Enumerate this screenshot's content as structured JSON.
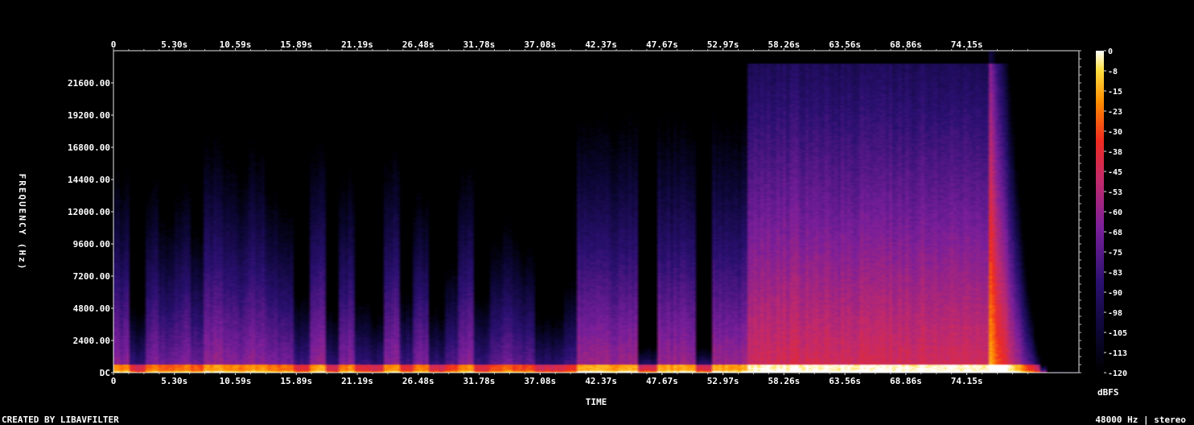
{
  "chart_data": {
    "type": "heatmap",
    "title": "",
    "xlabel": "TIME",
    "ylabel": "FREQUENCY (Hz)",
    "x_ticks": [
      "0",
      "5.30s",
      "10.59s",
      "15.89s",
      "21.19s",
      "26.48s",
      "31.78s",
      "37.08s",
      "42.37s",
      "47.67s",
      "52.97s",
      "58.26s",
      "63.56s",
      "68.86s",
      "74.15s"
    ],
    "x_range_s": [
      0,
      83.9
    ],
    "y_ticks": [
      "DC",
      "2400.00",
      "4800.00",
      "7200.00",
      "9600.00",
      "12000.00",
      "14400.00",
      "16800.00",
      "19200.00",
      "21600.00"
    ],
    "y_range_hz": [
      0,
      24000
    ],
    "colorbar": {
      "label": "dBFS",
      "ticks": [
        "0",
        "-8",
        "-15",
        "-23",
        "-30",
        "-38",
        "-45",
        "-53",
        "-60",
        "-68",
        "-75",
        "-83",
        "-90",
        "-98",
        "-105",
        "-113",
        "-120"
      ],
      "range_db": [
        -120,
        0
      ]
    },
    "colormap": "intensity",
    "grid": false
  },
  "footer": {
    "left": "CREATED BY LIBAVFILTER",
    "right": "48000 Hz | stereo"
  }
}
